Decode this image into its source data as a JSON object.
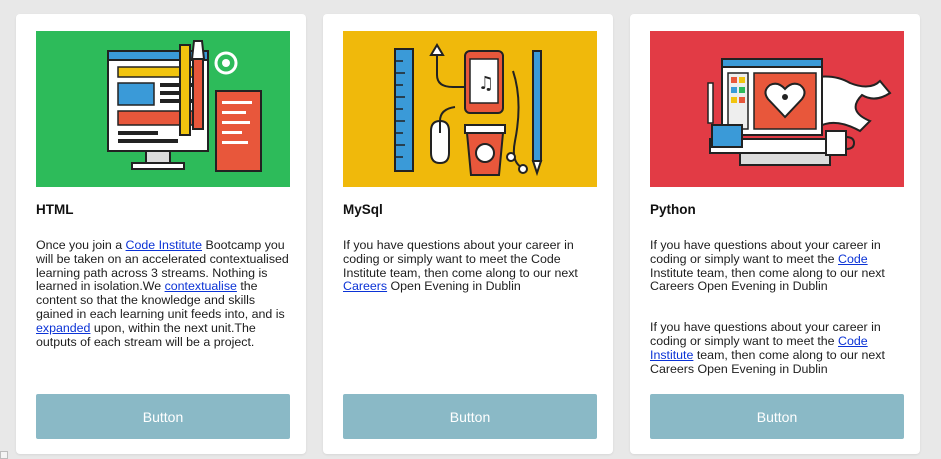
{
  "cards": [
    {
      "title": "HTML",
      "hero_color": "#2dbb5a",
      "hero_icon": "monitor-design-tools-illustration",
      "body": [
        [
          {
            "t": "Once you join a "
          },
          {
            "t": "Code Institute",
            "link": true
          },
          {
            "t": " Bootcamp you will be taken on an accelerated contextualised learning path across 3 streams. Nothing is learned in isolation.We "
          },
          {
            "t": "contextualise",
            "link": true
          },
          {
            "t": " the content so that the knowledge and skills gained in each learning unit feeds into, and is "
          },
          {
            "t": "expanded",
            "link": true
          },
          {
            "t": " upon, within the next unit.The outputs of each stream will be a project."
          }
        ]
      ],
      "button": "Button"
    },
    {
      "title": "MySql",
      "hero_color": "#f0b90b",
      "hero_icon": "gadgets-coffee-illustration",
      "body": [
        [
          {
            "t": "If you have questions about your career in coding or simply want to meet the Code Institute team, then come along to our next "
          },
          {
            "t": "Careers",
            "link": true
          },
          {
            "t": " Open Evening in Dublin"
          }
        ]
      ],
      "button": "Button"
    },
    {
      "title": "Python",
      "hero_color": "#e23b45",
      "hero_icon": "computer-heart-illustration",
      "body": [
        [
          {
            "t": "If you have questions about your career in coding or simply want to meet the "
          },
          {
            "t": "Code",
            "link": true
          },
          {
            "t": " Institute team, then come along to our next Careers Open Evening in Dublin"
          }
        ],
        [
          {
            "t": "If you have questions about your career in coding or simply want to meet the "
          },
          {
            "t": "Code Institute",
            "link": true
          },
          {
            "t": " team, then come along to our next Careers Open Evening in Dublin"
          }
        ]
      ],
      "button": "Button"
    }
  ],
  "colors": {
    "background": "#e8e8e8",
    "button": "#8ab9c6",
    "link": "#0b33d6"
  }
}
